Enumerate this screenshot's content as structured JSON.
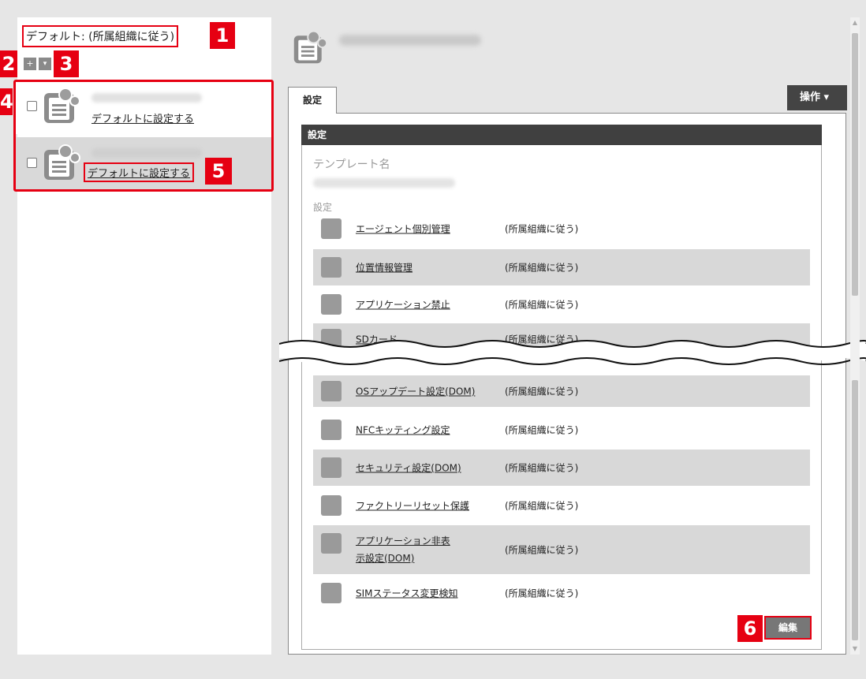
{
  "left_pane": {
    "default_label": "デフォルト: (所属組織に従う)",
    "add_button": "+",
    "menu_button": "▾",
    "templates": [
      {
        "link": "デフォルトに設定する"
      },
      {
        "link": "デフォルトに設定する"
      }
    ]
  },
  "callouts": [
    "1",
    "2",
    "3",
    "4",
    "5",
    "6"
  ],
  "right_pane": {
    "tab_label": "設定",
    "ops_label": "操作 ▾",
    "section_title": "設定",
    "template_name_label": "テンプレート名",
    "settings_label": "設定",
    "settings": [
      {
        "name": "エージェント個別管理",
        "value": "(所属組織に従う)",
        "icon": "agent-icon"
      },
      {
        "name": "位置情報管理",
        "value": "(所属組織に従う)",
        "icon": "location-icon"
      },
      {
        "name": "アプリケーション禁止",
        "value": "(所属組織に従う)",
        "icon": "app-block-icon"
      },
      {
        "name": "SDカード",
        "value": "(所属組織に従う)",
        "icon": "sd-card-icon"
      },
      {
        "name": "OSアップデート設定(DOM)",
        "value": "(所属組織に従う)",
        "icon": "os-update-icon"
      },
      {
        "name": "NFCキッティング設定",
        "value": "(所属組織に従う)",
        "icon": "nfc-icon"
      },
      {
        "name": "セキュリティ設定(DOM)",
        "value": "(所属組織に従う)",
        "icon": "security-icon"
      },
      {
        "name": "ファクトリーリセット保護",
        "value": "(所属組織に従う)",
        "icon": "factory-reset-icon"
      },
      {
        "name": "アプリケーション非表示設定(DOM)",
        "value": "(所属組織に従う)",
        "icon": "app-hide-icon"
      },
      {
        "name": "SIMステータス変更検知",
        "value": "(所属組織に従う)",
        "icon": "sim-icon"
      }
    ],
    "edit_label": "編集"
  }
}
